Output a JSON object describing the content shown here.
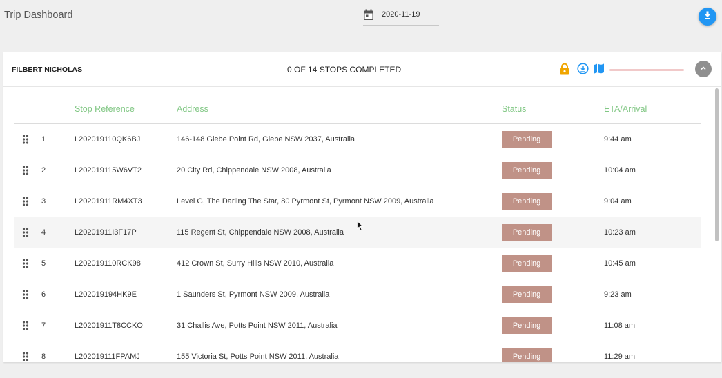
{
  "app": {
    "title": "Trip Dashboard"
  },
  "toolbar": {
    "date": "2020-11-19"
  },
  "card": {
    "driver_name": "FILBERT NICHOLAS",
    "stops_summary": "0 OF 14 STOPS COMPLETED",
    "progress_fraction": 0.0,
    "icons": [
      "lock-icon",
      "download-circle-icon",
      "map-icon",
      "collapse-up-icon"
    ]
  },
  "table": {
    "headers": {
      "ref": "Stop Reference",
      "address": "Address",
      "status": "Status",
      "eta": "ETA/Arrival"
    },
    "rows": [
      {
        "num": "1",
        "ref": "L202019110QK6BJ",
        "address": "146-148 Glebe Point Rd, Glebe NSW 2037, Australia",
        "status": "Pending",
        "eta": "9:44 am"
      },
      {
        "num": "2",
        "ref": "L202019115W6VT2",
        "address": "20 City Rd, Chippendale NSW 2008, Australia",
        "status": "Pending",
        "eta": "10:04 am"
      },
      {
        "num": "3",
        "ref": "L20201911RM4XT3",
        "address": "Level G, The Darling The Star, 80 Pyrmont St, Pyrmont NSW 2009, Australia",
        "status": "Pending",
        "eta": "9:04 am"
      },
      {
        "num": "4",
        "ref": "L20201911I3F17P",
        "address": "115 Regent St, Chippendale NSW 2008, Australia",
        "status": "Pending",
        "eta": "10:23 am"
      },
      {
        "num": "5",
        "ref": "L202019110RCK98",
        "address": "412 Crown St, Surry Hills NSW 2010, Australia",
        "status": "Pending",
        "eta": "10:45 am"
      },
      {
        "num": "6",
        "ref": "L202019194HK9E",
        "address": "1 Saunders St, Pyrmont NSW 2009, Australia",
        "status": "Pending",
        "eta": "9:23 am"
      },
      {
        "num": "7",
        "ref": "L20201911T8CCKO",
        "address": "31 Challis Ave, Potts Point NSW 2011, Australia",
        "status": "Pending",
        "eta": "11:08 am"
      },
      {
        "num": "8",
        "ref": "L202019111FPAMJ",
        "address": "155 Victoria St, Potts Point NSW 2011, Australia",
        "status": "Pending",
        "eta": "11:29 am"
      }
    ]
  },
  "colors": {
    "header_text": "#81c784",
    "status_pending": "#c09287",
    "accent_blue": "#2196f3",
    "lock": "#f0a500",
    "progress": "#e57373"
  }
}
